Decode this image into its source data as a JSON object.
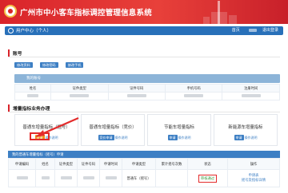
{
  "header": {
    "system_title": "广州市中小客车指标调控管理信息系统"
  },
  "userbar": {
    "title": "用户中心（个人）",
    "links": [
      "首页",
      "退出登录",
      "退出登录"
    ]
  },
  "account_section": {
    "title": "账号",
    "buttons": [
      "修改资料",
      "修改密码",
      "修改手机"
    ],
    "bar_label": "我的账号",
    "columns": [
      "姓名",
      "证件类型",
      "证件号码",
      "手机号码",
      "注册时间"
    ]
  },
  "business_section": {
    "title": "增量指标业务办理",
    "cards": [
      {
        "title": "普通车增量指标（摇号）",
        "apply": "申请",
        "guide": "操作说明"
      },
      {
        "title": "普通车增量指标（竞价）",
        "apply": "竞价申请",
        "guide": "操作说明"
      },
      {
        "title": "节能车增量指标",
        "apply": "申请",
        "guide": "操作说明"
      },
      {
        "title": "新能源车增量指标",
        "apply": "申请",
        "guide": "操作说明"
      }
    ],
    "highlight_color": "#e32b2b",
    "accent_color": "#3d7fc4",
    "orange_color": "#f0941b"
  },
  "application_section": {
    "bar_label": "我的普通车增量指标（摇号）申请",
    "columns": [
      "申请编码",
      "姓名",
      "证件类型",
      "证件号码",
      "申请时间",
      "申请类型",
      "累计摇号次数",
      "状态",
      "操作"
    ],
    "row": {
      "type": "普通车（摇号）",
      "count": "",
      "status": "审核通过",
      "op1": "申请表",
      "op2": "摇号及指标详情"
    }
  }
}
